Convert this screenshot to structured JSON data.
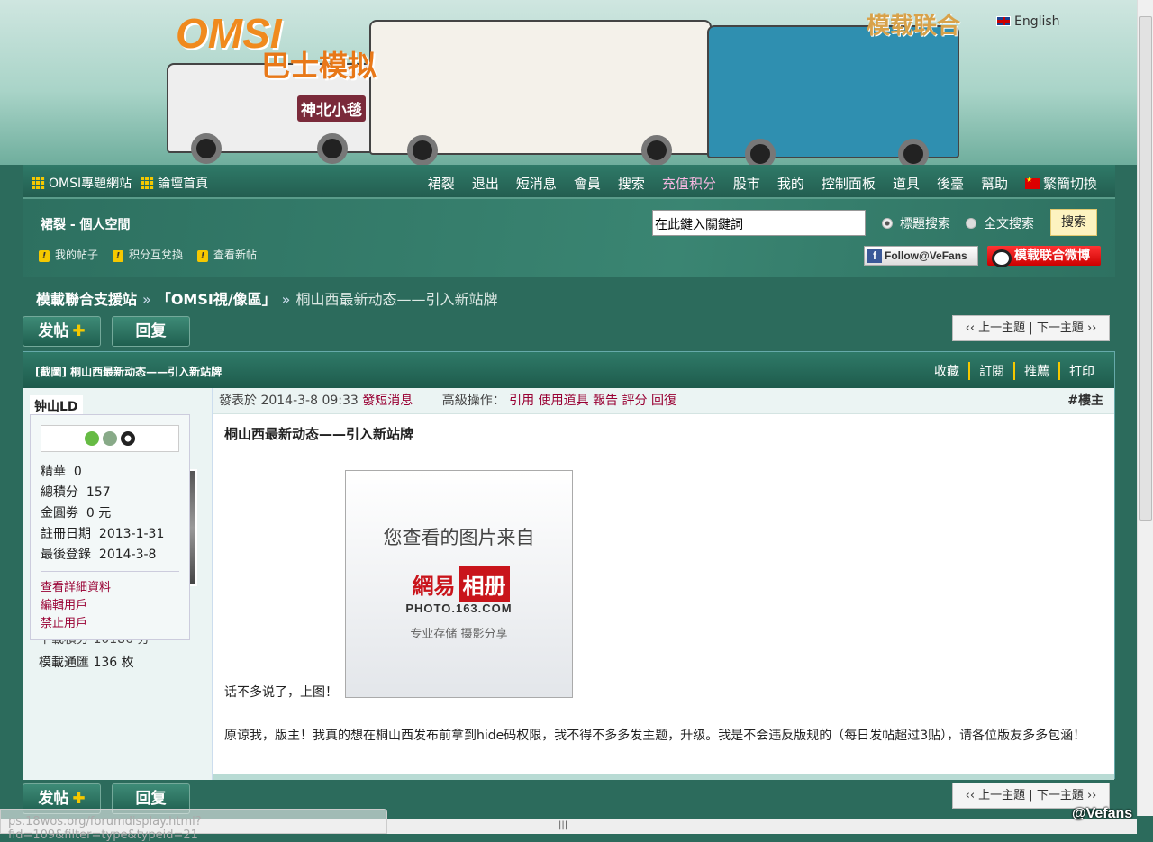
{
  "banner": {
    "logo": "OMSI",
    "logo_sub": "巴士模拟",
    "brand": "模载联合",
    "bus_sign": "神北小毯",
    "language": "English"
  },
  "nav": {
    "left": [
      "OMSI專題網站",
      "論壇首頁"
    ],
    "right": [
      "裙裂",
      "退出",
      "短消息",
      "會員",
      "搜索",
      "充值积分",
      "股市",
      "我的",
      "控制面板",
      "道具",
      "後臺",
      "幫助",
      "繁簡切換"
    ]
  },
  "sub": {
    "space_title": "裙裂 - 個人空間",
    "quick_links": [
      "我的帖子",
      "积分互兌換",
      "查看新帖"
    ],
    "search_value": "在此鍵入關鍵詞",
    "radio_title": "標題搜索",
    "radio_full": "全文搜索",
    "search_button": "搜索",
    "facebook": "Follow@VeFans",
    "weibo": "模载联合微博"
  },
  "breadcrumb": {
    "home": "模載聯合支援站",
    "forum": "「OMSI視/像區」",
    "current": "桐山西最新动态——引入新站牌"
  },
  "buttons": {
    "new_post": "发帖",
    "reply": "回复",
    "prev_topic": "‹‹ 上一主題",
    "next_topic": "下一主題 ››"
  },
  "thread": {
    "title": "[截圖] 桐山西最新动态——引入新站牌",
    "actions": [
      "收藏",
      "訂閱",
      "推薦",
      "打印"
    ]
  },
  "user": {
    "name": "钟山LD",
    "stats": [
      {
        "label": "精華",
        "value": "0"
      },
      {
        "label": "總積分",
        "value": "157"
      },
      {
        "label": "金圓劵",
        "value": "0 元"
      },
      {
        "label": "註冊日期",
        "value": "2013-1-31"
      },
      {
        "label": "最後登錄",
        "value": "2014-3-8"
      }
    ],
    "links": [
      "查看詳細資料",
      "編輯用戶",
      "禁止用戶"
    ],
    "hidden_stat": "下載積分 10186 分",
    "tokens": "模載通匯 136 枚"
  },
  "post": {
    "posted_prefix": "發表於",
    "posted_time": "2014-3-8 09:33",
    "pm": "發短消息",
    "adv_label": "高級操作：",
    "adv_actions": [
      "引用",
      "使用道具",
      "報告",
      "評分",
      "回復"
    ],
    "floor": "#樓主",
    "title": "桐山西最新动态——引入新站牌",
    "line1": "话不多说了，上图！",
    "image": {
      "line1": "您查看的图片来自",
      "brand_a": "網易",
      "brand_b": "相册",
      "domain": "PHOTO.163.COM",
      "tagline": "专业存储  摄影分享"
    },
    "para": "原谅我，版主！我真的想在桐山西发布前拿到hide码权限，我不得不多多发主题，升级。我是不会违反版规的（每日发帖超过3贴），请各位版友多多包涵！"
  },
  "status_url": "ps.18wos.org/forumdisplay.html?fid=109&filter=type&typeid=21",
  "watermark": "@Vefans"
}
